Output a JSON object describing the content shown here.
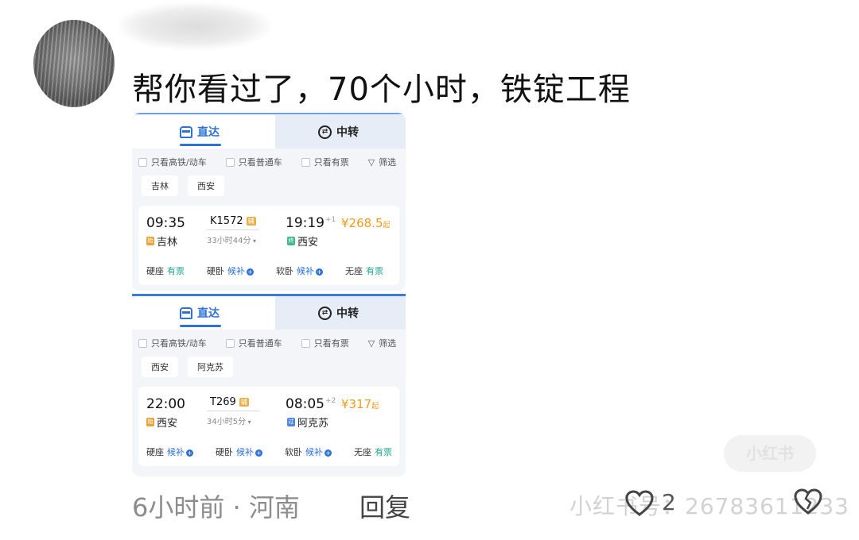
{
  "comment": {
    "text": "帮你看过了，70个小时，铁锭工程",
    "time_location": "6小时前 · 河南",
    "reply_label": "回复",
    "like_count": "2",
    "watermark_id": "小红书号：26783611233",
    "watermark_logo": "小红书"
  },
  "screenshots": [
    {
      "tab_direct": "直达",
      "tab_transfer": "中转",
      "filters": [
        "只看高铁/动车",
        "只看普通车",
        "只看有票"
      ],
      "filter_button": "筛选",
      "from_chip": "吉林",
      "to_chip": "西安",
      "dep_time": "09:35",
      "train_no": "K1572",
      "train_badge": "辅",
      "arr_time": "19:19",
      "arr_day": "+1",
      "duration": "33小时44分",
      "dep_station": "吉林",
      "dep_tag": "始",
      "arr_station": "西安",
      "arr_tag": "终",
      "price": "¥268.5",
      "price_suffix": "起",
      "seats": [
        {
          "label": "硬座",
          "status": "有票",
          "type": "ok"
        },
        {
          "label": "硬卧",
          "status": "候补",
          "type": "wait"
        },
        {
          "label": "软卧",
          "status": "候补",
          "type": "wait"
        },
        {
          "label": "无座",
          "status": "有票",
          "type": "ok"
        }
      ],
      "colors": {
        "dep_tag": "#e8a33a",
        "arr_tag": "#3fb98a"
      }
    },
    {
      "tab_direct": "直达",
      "tab_transfer": "中转",
      "filters": [
        "只看高铁/动车",
        "只看普通车",
        "只看有票"
      ],
      "filter_button": "筛选",
      "from_chip": "西安",
      "to_chip": "阿克苏",
      "dep_time": "22:00",
      "train_no": "T269",
      "train_badge": "辅",
      "arr_time": "08:05",
      "arr_day": "+2",
      "duration": "34小时5分",
      "dep_station": "西安",
      "dep_tag": "始",
      "arr_station": "阿克苏",
      "arr_tag": "过",
      "price": "¥317",
      "price_suffix": "起",
      "seats": [
        {
          "label": "硬座",
          "status": "候补",
          "type": "wait"
        },
        {
          "label": "硬卧",
          "status": "候补",
          "type": "wait"
        },
        {
          "label": "软卧",
          "status": "候补",
          "type": "wait"
        },
        {
          "label": "无座",
          "status": "有票",
          "type": "ok"
        }
      ],
      "colors": {
        "dep_tag": "#e8a33a",
        "arr_tag": "#4d86e0"
      }
    }
  ],
  "colors": {
    "accent": "#2d72d9",
    "price": "#f29b1a",
    "ok": "#22a98a"
  }
}
